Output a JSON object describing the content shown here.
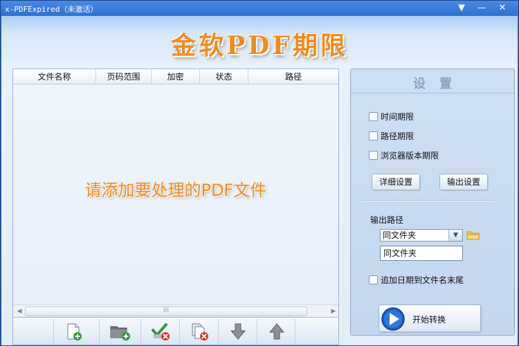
{
  "window": {
    "title": "x-PDFExpired（未激活）",
    "controls": {
      "menu": "▼",
      "minimize": "—",
      "close": "✕"
    }
  },
  "banner": {
    "title": "金软PDF期限"
  },
  "file_table": {
    "columns": [
      "文件名称",
      "页码范围",
      "加密",
      "状态",
      "路径"
    ],
    "rows": [],
    "empty_hint": "请添加要处理的PDF文件",
    "scroll_grip": "III"
  },
  "toolbar": {
    "buttons": [
      {
        "name": "add-file-button",
        "icon": "add-file-icon"
      },
      {
        "name": "add-folder-button",
        "icon": "add-folder-icon"
      },
      {
        "name": "remove-checked-button",
        "icon": "remove-checked-icon"
      },
      {
        "name": "remove-all-button",
        "icon": "remove-all-icon"
      },
      {
        "name": "move-down-button",
        "icon": "arrow-down-icon"
      },
      {
        "name": "move-up-button",
        "icon": "arrow-up-icon"
      }
    ]
  },
  "settings": {
    "title": "设置",
    "options": [
      {
        "label": "时间期限",
        "checked": false
      },
      {
        "label": "路径期限",
        "checked": false
      },
      {
        "label": "浏览器版本期限",
        "checked": false
      }
    ],
    "detail_button": "详细设置",
    "output_button": "输出设置",
    "output_path_label": "输出路径",
    "output_select_value": "同文件夹",
    "output_path_value": "同文件夹",
    "append_date_label": "追加日期到文件名末尾",
    "append_date_checked": false,
    "start_button": "开始转换"
  },
  "colors": {
    "title_bar": "#2e6fd0",
    "banner_text": "#f08c1e",
    "accent_blue": "#1f5fc4"
  }
}
